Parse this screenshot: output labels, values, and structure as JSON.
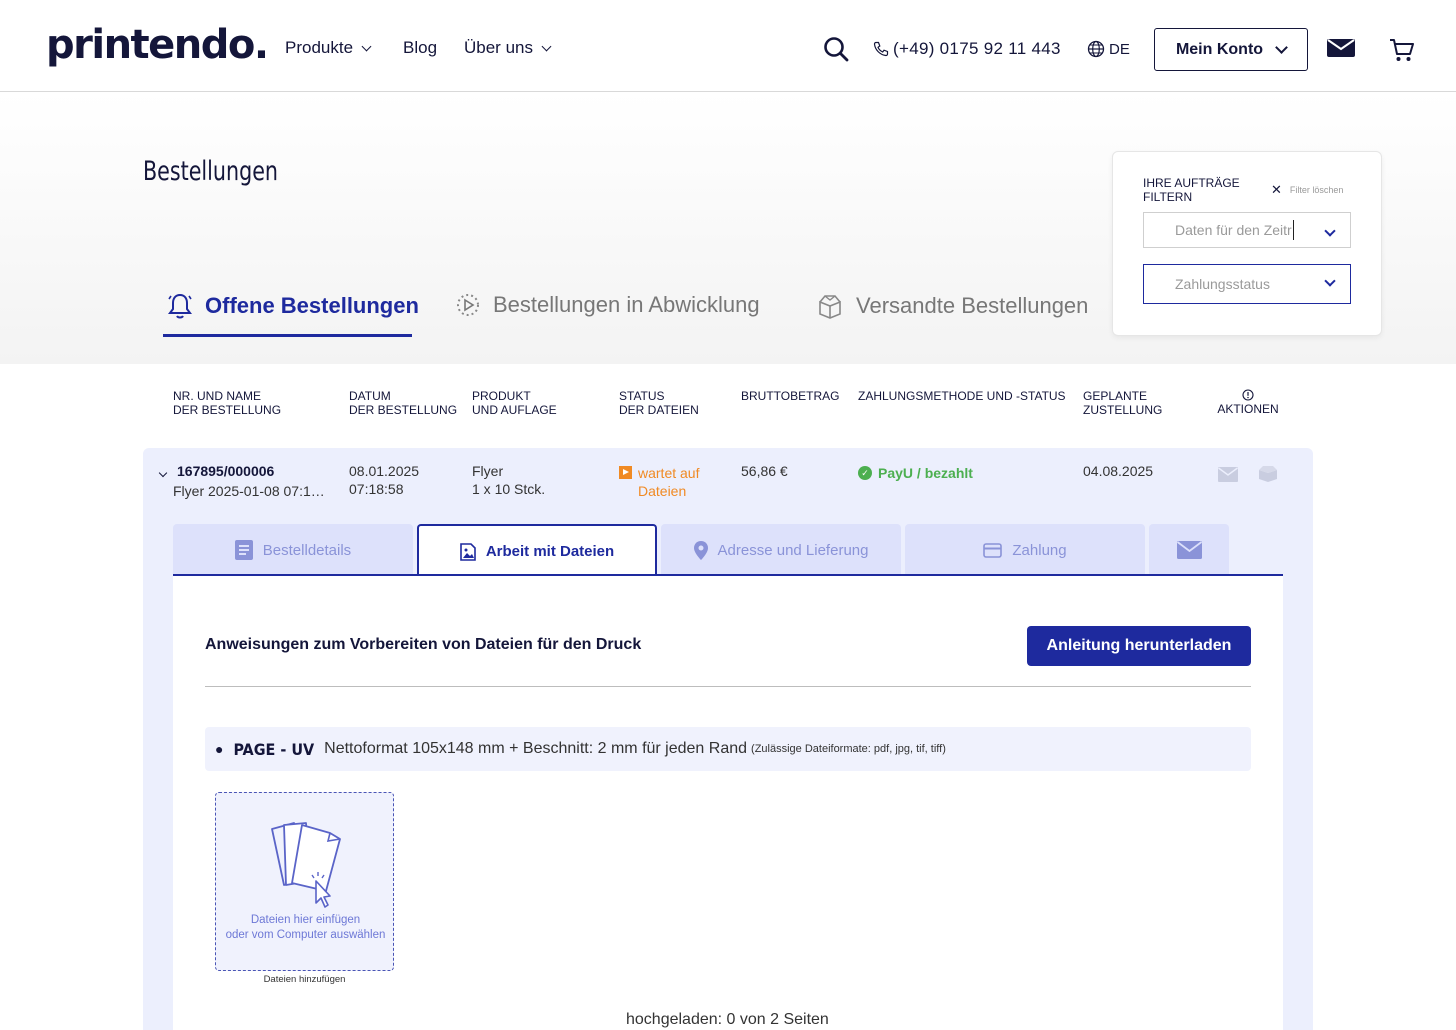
{
  "header": {
    "logo": "printendo.",
    "nav": [
      "Produkte",
      "Blog",
      "Über uns"
    ],
    "phone": "(+49) 0175 92 11 443",
    "lang": "DE",
    "account": "Mein Konto"
  },
  "page": {
    "title": "Bestellungen"
  },
  "tabs": [
    "Offene Bestellungen",
    "Bestellungen in Abwicklung",
    "Versandte Bestellungen"
  ],
  "filter": {
    "title": "IHRE AUFTRÄGE FILTERN",
    "clear": "Filter löschen",
    "date_placeholder": "Daten für den Zeitr",
    "payment_placeholder": "Zahlungsstatus"
  },
  "table_headers": {
    "nr": "NR. UND NAME",
    "nr2": "DER BESTELLUNG",
    "date": "DATUM",
    "date2": "DER BESTELLUNG",
    "product": "PRODUKT",
    "product2": "UND AUFLAGE",
    "status": "STATUS",
    "status2": "DER DATEIEN",
    "gross": "BRUTTOBETRAG",
    "payment": "ZAHLUNGSMETHODE UND -STATUS",
    "delivery": "GEPLANTE",
    "delivery2": "ZUSTELLUNG",
    "actions": "AKTIONEN"
  },
  "order": {
    "number": "167895/000006",
    "name": "Flyer 2025-01-08 07:1…",
    "date": "08.01.2025",
    "time": "07:18:58",
    "product": "Flyer",
    "quantity": "1 x 10 Stck.",
    "file_status_1": "wartet auf",
    "file_status_2": "Dateien",
    "gross": "56,86 €",
    "payment": "PayU / bezahlt",
    "delivery": "04.08.2025"
  },
  "order_tabs": [
    "Bestelldetails",
    "Arbeit mit Dateien",
    "Adresse und Lieferung",
    "Zahlung"
  ],
  "files": {
    "instructions_title": "Anweisungen zum Vorbereiten von Dateien für den Druck",
    "download_button": "Anleitung herunterladen",
    "page_name": "PAGE - UV",
    "page_spec": "Nettoformat 105x148 mm + Beschnitt: 2 mm für jeden Rand",
    "page_formats": "(Zulässige Dateiformate: pdf, jpg, tif, tiff)",
    "dropzone_line1": "Dateien hier einfügen",
    "dropzone_line2": "oder vom Computer auswählen",
    "dropzone_caption": "Dateien hinzufügen",
    "uploaded": "hochgeladen: 0 von 2 Seiten"
  },
  "colors": {
    "brand": "#1e2a9e",
    "warning": "#f08a24",
    "success": "#4caf50",
    "panel": "#eceffd"
  }
}
